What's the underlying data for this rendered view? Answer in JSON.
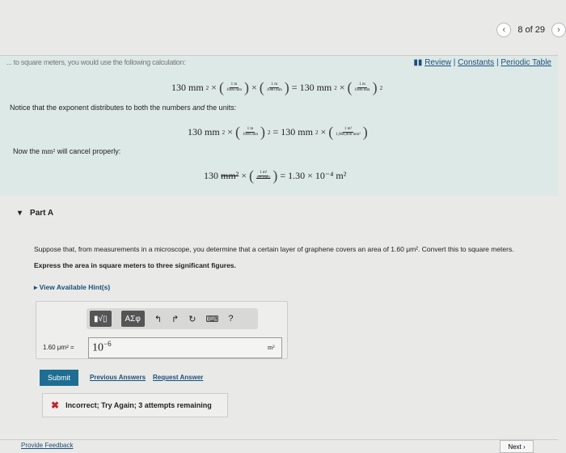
{
  "nav": {
    "prev_icon": "chevron-left-icon",
    "position": "8 of 29",
    "next_icon": "chevron-right-icon"
  },
  "faded_text": "... to square meters, you would use the following calculation:",
  "links": {
    "icon": "book-icon",
    "review": "Review",
    "sep": "|",
    "constants": "Constants",
    "periodic": "Periodic Table"
  },
  "solution": {
    "eq1": {
      "a": "130 mm",
      "x": "×",
      "f_num": "1 m",
      "f_den": "1000 mm",
      "eq": "=",
      "b": "130 mm",
      "exp": "2"
    },
    "notice": "Notice that the exponent distributes to both the numbers ",
    "notice_em": "and",
    "notice_end": " the units:",
    "eq2": {
      "f2_num": "1 m²",
      "f2_den": "1,000,000 mm²"
    },
    "cancel_pre": "Now the ",
    "cancel_unit": "mm²",
    "cancel_post": " will cancel properly:",
    "eq3": {
      "a": "130",
      "unit": "mm²",
      "f_num": "1 m²",
      "f_den": "10⁶ mm²",
      "result": "= 1.30 × 10⁻⁴ m²"
    }
  },
  "part": {
    "label": "Part A"
  },
  "question": {
    "text": "Suppose that, from measurements in a microscope, you determine that a certain layer of graphene covers an area of 1.60 μm². Convert this to square meters.",
    "instruction": "Express the area in square meters to three significant figures.",
    "hints": "View Available Hint(s)"
  },
  "answer": {
    "label": "1.60 μm² =",
    "value": "10",
    "exp": "−6",
    "unit": "m²",
    "toolbar": {
      "templates": "▮√▯",
      "greek": "ΑΣφ",
      "undo": "↰",
      "redo": "↱",
      "reset": "↻",
      "keyboard": "⌨",
      "help": "?"
    }
  },
  "actions": {
    "submit": "Submit",
    "previous": "Previous Answers",
    "request": "Request Answer"
  },
  "feedback": {
    "icon": "✖",
    "text": "Incorrect; Try Again; 3 attempts remaining"
  },
  "footer": {
    "provide": "Provide Feedback",
    "next": "Next ›"
  }
}
